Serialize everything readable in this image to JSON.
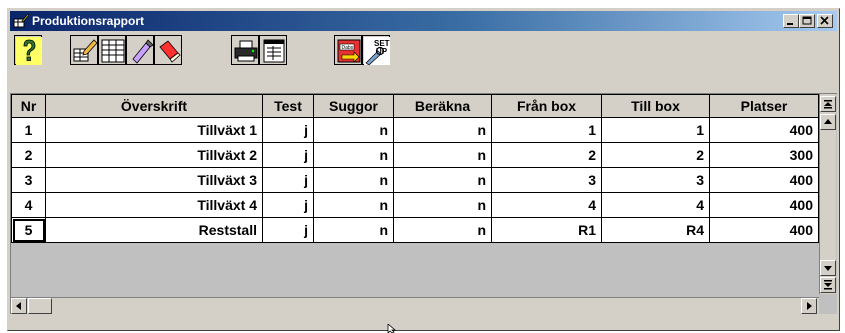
{
  "window": {
    "title": "Produktionsrapport"
  },
  "toolbar": {
    "tools": [
      {
        "name": "help-button",
        "icon": "question-icon"
      },
      {
        "name": "edit-layout-button",
        "icon": "pencil-table-icon"
      },
      {
        "name": "grid-button",
        "icon": "grid-icon"
      },
      {
        "name": "marker-button",
        "icon": "marker-icon"
      },
      {
        "name": "eraser-button",
        "icon": "eraser-icon"
      },
      {
        "name": "print-button",
        "icon": "printer-icon"
      },
      {
        "name": "form-button",
        "icon": "form-icon"
      },
      {
        "name": "database-button",
        "icon": "database-icon"
      },
      {
        "name": "setup-button",
        "icon": "setup-icon"
      }
    ],
    "db_label": "Dabs",
    "setup_label_1": "SET",
    "setup_label_2": "UP"
  },
  "table": {
    "columns": [
      "Nr",
      "Överskrift",
      "Test",
      "Suggor",
      "Beräkna",
      "Från box",
      "Till box",
      "Platser"
    ],
    "rows": [
      [
        "1",
        "Tillväxt 1",
        "j",
        "n",
        "n",
        "1",
        "1",
        "400"
      ],
      [
        "2",
        "Tillväxt 2",
        "j",
        "n",
        "n",
        "2",
        "2",
        "300"
      ],
      [
        "3",
        "Tillväxt 3",
        "j",
        "n",
        "n",
        "3",
        "3",
        "400"
      ],
      [
        "4",
        "Tillväxt 4",
        "j",
        "n",
        "n",
        "4",
        "4",
        "400"
      ],
      [
        "5",
        "Reststall",
        "j",
        "n",
        "n",
        "R1",
        "R4",
        "400"
      ]
    ],
    "active_row": 5
  },
  "colors": {
    "title_start": "#0a246a",
    "title_end": "#a6caf0",
    "face": "#d4d0c8",
    "grid_empty": "#c0c0c0"
  }
}
